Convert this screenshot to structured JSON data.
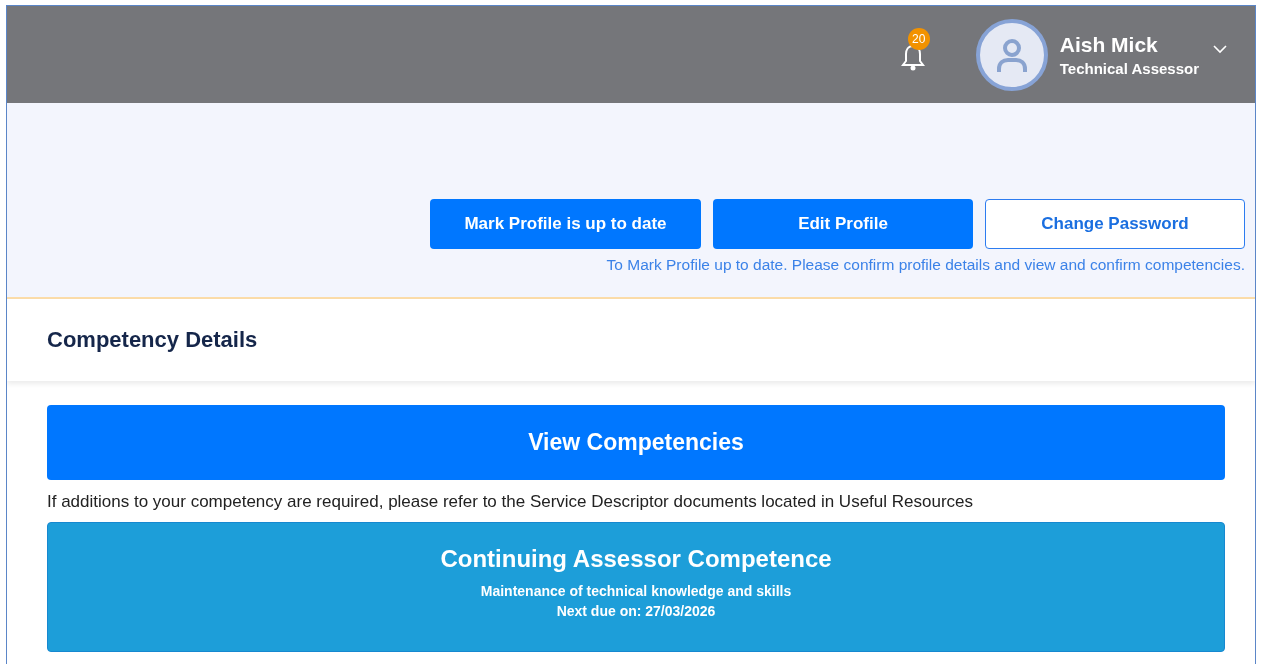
{
  "header": {
    "notification_count": "20",
    "user": {
      "name": "Aish Mick",
      "role": "Technical Assessor"
    }
  },
  "profile_actions": {
    "buttons": [
      {
        "label": "Mark Profile is up to date",
        "kind": "primary"
      },
      {
        "label": "Edit Profile",
        "kind": "primary"
      },
      {
        "label": "Change Password",
        "kind": "outline"
      }
    ],
    "note": "To Mark Profile up to date. Please confirm profile details and view and confirm competencies."
  },
  "competency_details": {
    "title": "Competency Details",
    "view_button": "View Competencies",
    "hint": "If additions to your competency are required, please refer to the Service Descriptor documents located in Useful Resources",
    "card": {
      "title": "Continuing Assessor Competence",
      "subtitle": "Maintenance of technical knowledge and skills",
      "due": "Next due on: 27/03/2026"
    }
  }
}
